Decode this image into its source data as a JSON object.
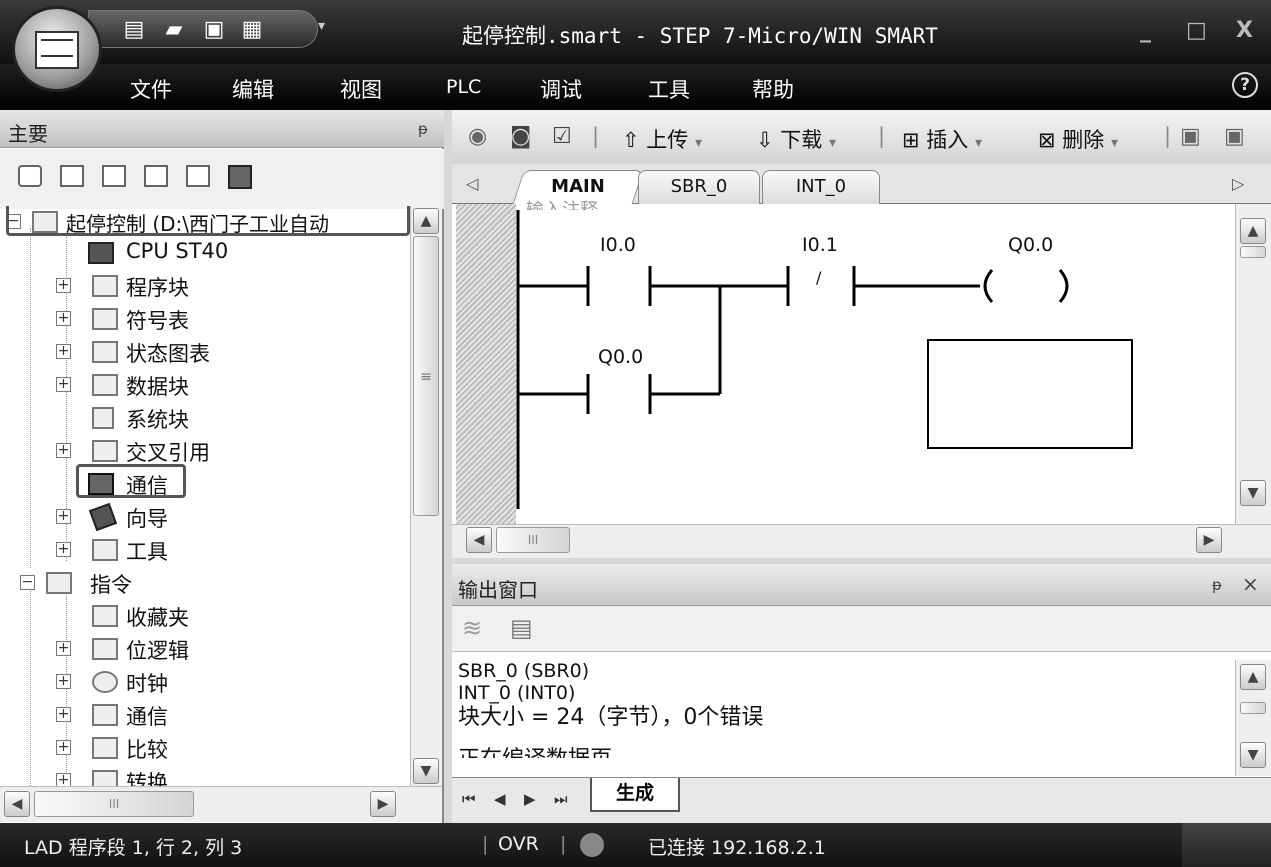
{
  "window": {
    "title": "起停控制.smart - STEP 7-Micro/WIN SMART",
    "minimize": "_",
    "maximize": "□",
    "close": "X"
  },
  "menu": [
    "文件",
    "编辑",
    "视图",
    "PLC",
    "调试",
    "工具",
    "帮助"
  ],
  "help_icon": "?",
  "left_panel": {
    "title": "主要",
    "pin": "ᵽ",
    "project_name": "起停控制 (D:\\西门子工业自动",
    "tree": [
      {
        "label": "CPU ST40",
        "icon": "cpu-icon"
      },
      {
        "label": "程序块",
        "icon": "program-block-icon"
      },
      {
        "label": "符号表",
        "icon": "symbol-table-icon"
      },
      {
        "label": "状态图表",
        "icon": "status-chart-icon"
      },
      {
        "label": "数据块",
        "icon": "data-block-icon"
      },
      {
        "label": "系统块",
        "icon": "system-block-icon"
      },
      {
        "label": "交叉引用",
        "icon": "cross-reference-icon"
      },
      {
        "label": "通信",
        "icon": "communication-icon"
      },
      {
        "label": "向导",
        "icon": "wizard-icon"
      },
      {
        "label": "工具",
        "icon": "tools-icon"
      },
      {
        "label": "指令",
        "icon": "instructions-icon"
      },
      {
        "label": "收藏夹",
        "icon": "favorites-icon"
      },
      {
        "label": "位逻辑",
        "icon": "bit-logic-icon"
      },
      {
        "label": "时钟",
        "icon": "clock-icon"
      },
      {
        "label": "通信",
        "icon": "communication-instr-icon"
      },
      {
        "label": "比较",
        "icon": "compare-icon"
      },
      {
        "label": "转换",
        "icon": "convert-icon"
      }
    ],
    "scroll_thumb_grip": "≡",
    "hscroll_grip": "III"
  },
  "editor": {
    "toolbar": {
      "upload": "上传",
      "download": "下载",
      "insert": "插入",
      "delete": "删除"
    },
    "tabs": [
      "MAIN",
      "SBR_0",
      "INT_0"
    ],
    "comment_partial": "输入注释",
    "contacts": {
      "c1": "I0.0",
      "c2": "I0.1",
      "c2_symbol": "/",
      "coil": "Q0.0",
      "c3": "Q0.0"
    },
    "hscroll_grip": "III"
  },
  "output": {
    "title": "输出窗口",
    "pin": "ᵽ",
    "close": "×",
    "lines": [
      "SBR_0 (SBR0)",
      "INT_0 (INT0)",
      "块大小 = 24（字节），0个错误",
      "正在编译数据页"
    ],
    "tab": "生成"
  },
  "status": {
    "position": "LAD 程序段 1, 行 2, 列 3",
    "mode": "OVR",
    "connection": "已连接 192.168.2.1"
  }
}
